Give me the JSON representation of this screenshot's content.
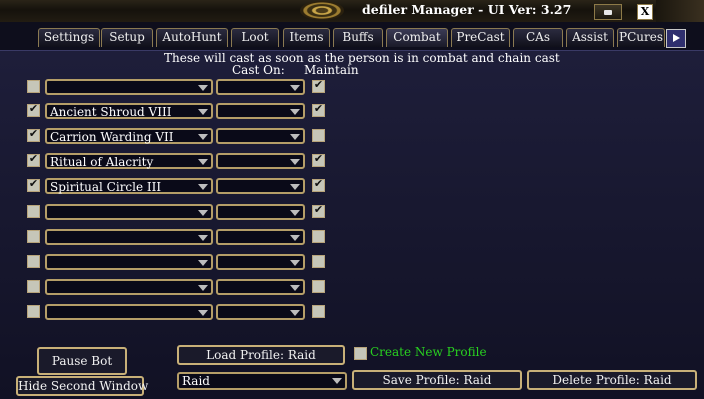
{
  "window": {
    "title": "defiler Manager  - UI Ver: 3.27",
    "minimize_label": "",
    "close_label": "X"
  },
  "tabs": [
    "Settings",
    "Setup",
    "AutoHunt",
    "Loot",
    "Items",
    "Buffs",
    "Combat",
    "PreCast",
    "CAs",
    "Assist",
    "PCures"
  ],
  "active_tab": "Combat",
  "combat": {
    "description": "These will cast as soon as the person is in combat and chain cast",
    "cast_on_header": "Cast On:",
    "maintain_header": "Maintain",
    "rows": [
      {
        "enabled": false,
        "spell": "",
        "cast_on": "",
        "maintain": true
      },
      {
        "enabled": true,
        "spell": "Ancient Shroud VIII",
        "cast_on": "",
        "maintain": true
      },
      {
        "enabled": true,
        "spell": "Carrion Warding VII",
        "cast_on": "",
        "maintain": false
      },
      {
        "enabled": true,
        "spell": "Ritual of Alacrity",
        "cast_on": "",
        "maintain": true
      },
      {
        "enabled": true,
        "spell": "Spiritual Circle III",
        "cast_on": "",
        "maintain": true
      },
      {
        "enabled": false,
        "spell": "",
        "cast_on": "",
        "maintain": true
      },
      {
        "enabled": false,
        "spell": "",
        "cast_on": "",
        "maintain": false
      },
      {
        "enabled": false,
        "spell": "",
        "cast_on": "",
        "maintain": false
      },
      {
        "enabled": false,
        "spell": "",
        "cast_on": "",
        "maintain": false
      },
      {
        "enabled": false,
        "spell": "",
        "cast_on": "",
        "maintain": false
      }
    ]
  },
  "footer": {
    "pause_bot": "Pause Bot",
    "hide_second_window": "Hide Second Window",
    "load_profile": "Load Profile: Raid",
    "profile_select": "Raid",
    "create_new_profile": "Create New Profile",
    "create_new_profile_checked": false,
    "save_profile": "Save Profile: Raid",
    "delete_profile": "Delete Profile: Raid"
  },
  "colors": {
    "accent_gold": "#c8b078",
    "create_profile_green": "#28d020"
  }
}
